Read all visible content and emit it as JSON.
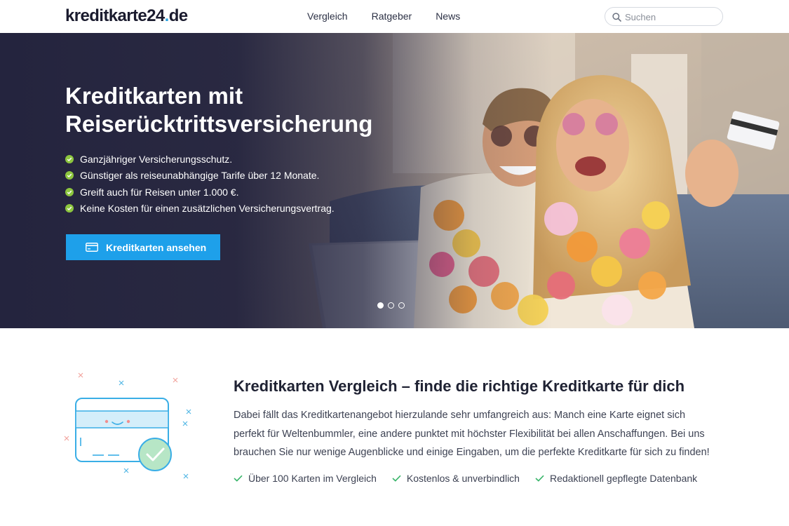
{
  "header": {
    "logo_main": "kreditkarte24",
    "logo_dot": ".",
    "logo_tld": "de",
    "nav": [
      {
        "label": "Vergleich"
      },
      {
        "label": "Ratgeber"
      },
      {
        "label": "News"
      }
    ],
    "search": {
      "placeholder": "Suchen",
      "value": "",
      "icon": "search-icon"
    }
  },
  "hero": {
    "title_line1": "Kreditkarten mit",
    "title_line2": "Reiserücktrittsversicherung",
    "features": [
      "Ganzjähriger Versicherungsschutz.",
      "Günstiger als reiseunabhängige Tarife über 12 Monate.",
      "Greift auch für Reisen unter 1.000 €.",
      "Keine Kosten für einen zusätzlichen Versicherungsvertrag."
    ],
    "cta_label": "Kreditkarten ansehen",
    "cta_icon": "credit-card-icon",
    "slider": {
      "total": 3,
      "active": 1
    }
  },
  "section": {
    "title": "Kreditkarten Vergleich – finde die richtige Kreditkarte für dich",
    "text_lines": [
      "Dabei fällt das Kreditkartenangebot hierzulande sehr umfangreich aus: Manch eine Karte eignet sich",
      "perfekt für Weltenbummler, eine andere punktet mit höchster Flexibilität bei allen Anschaffungen. Bei uns",
      "brauchen Sie nur wenige Augenblicke und einige Eingaben, um die perfekte Kreditkarte für sich zu finden!"
    ],
    "usps": [
      "Über 100 Karten im Vergleich",
      "Kostenlos & unverbindlich",
      "Redaktionell gepflegte Datenbank"
    ]
  },
  "colors": {
    "brand_dark": "#1a1b2e",
    "brand_blue": "#2aa4e3",
    "cta_blue": "#1ea0ea",
    "check_green": "#8dc63f",
    "hero_navy": "#24243e"
  }
}
